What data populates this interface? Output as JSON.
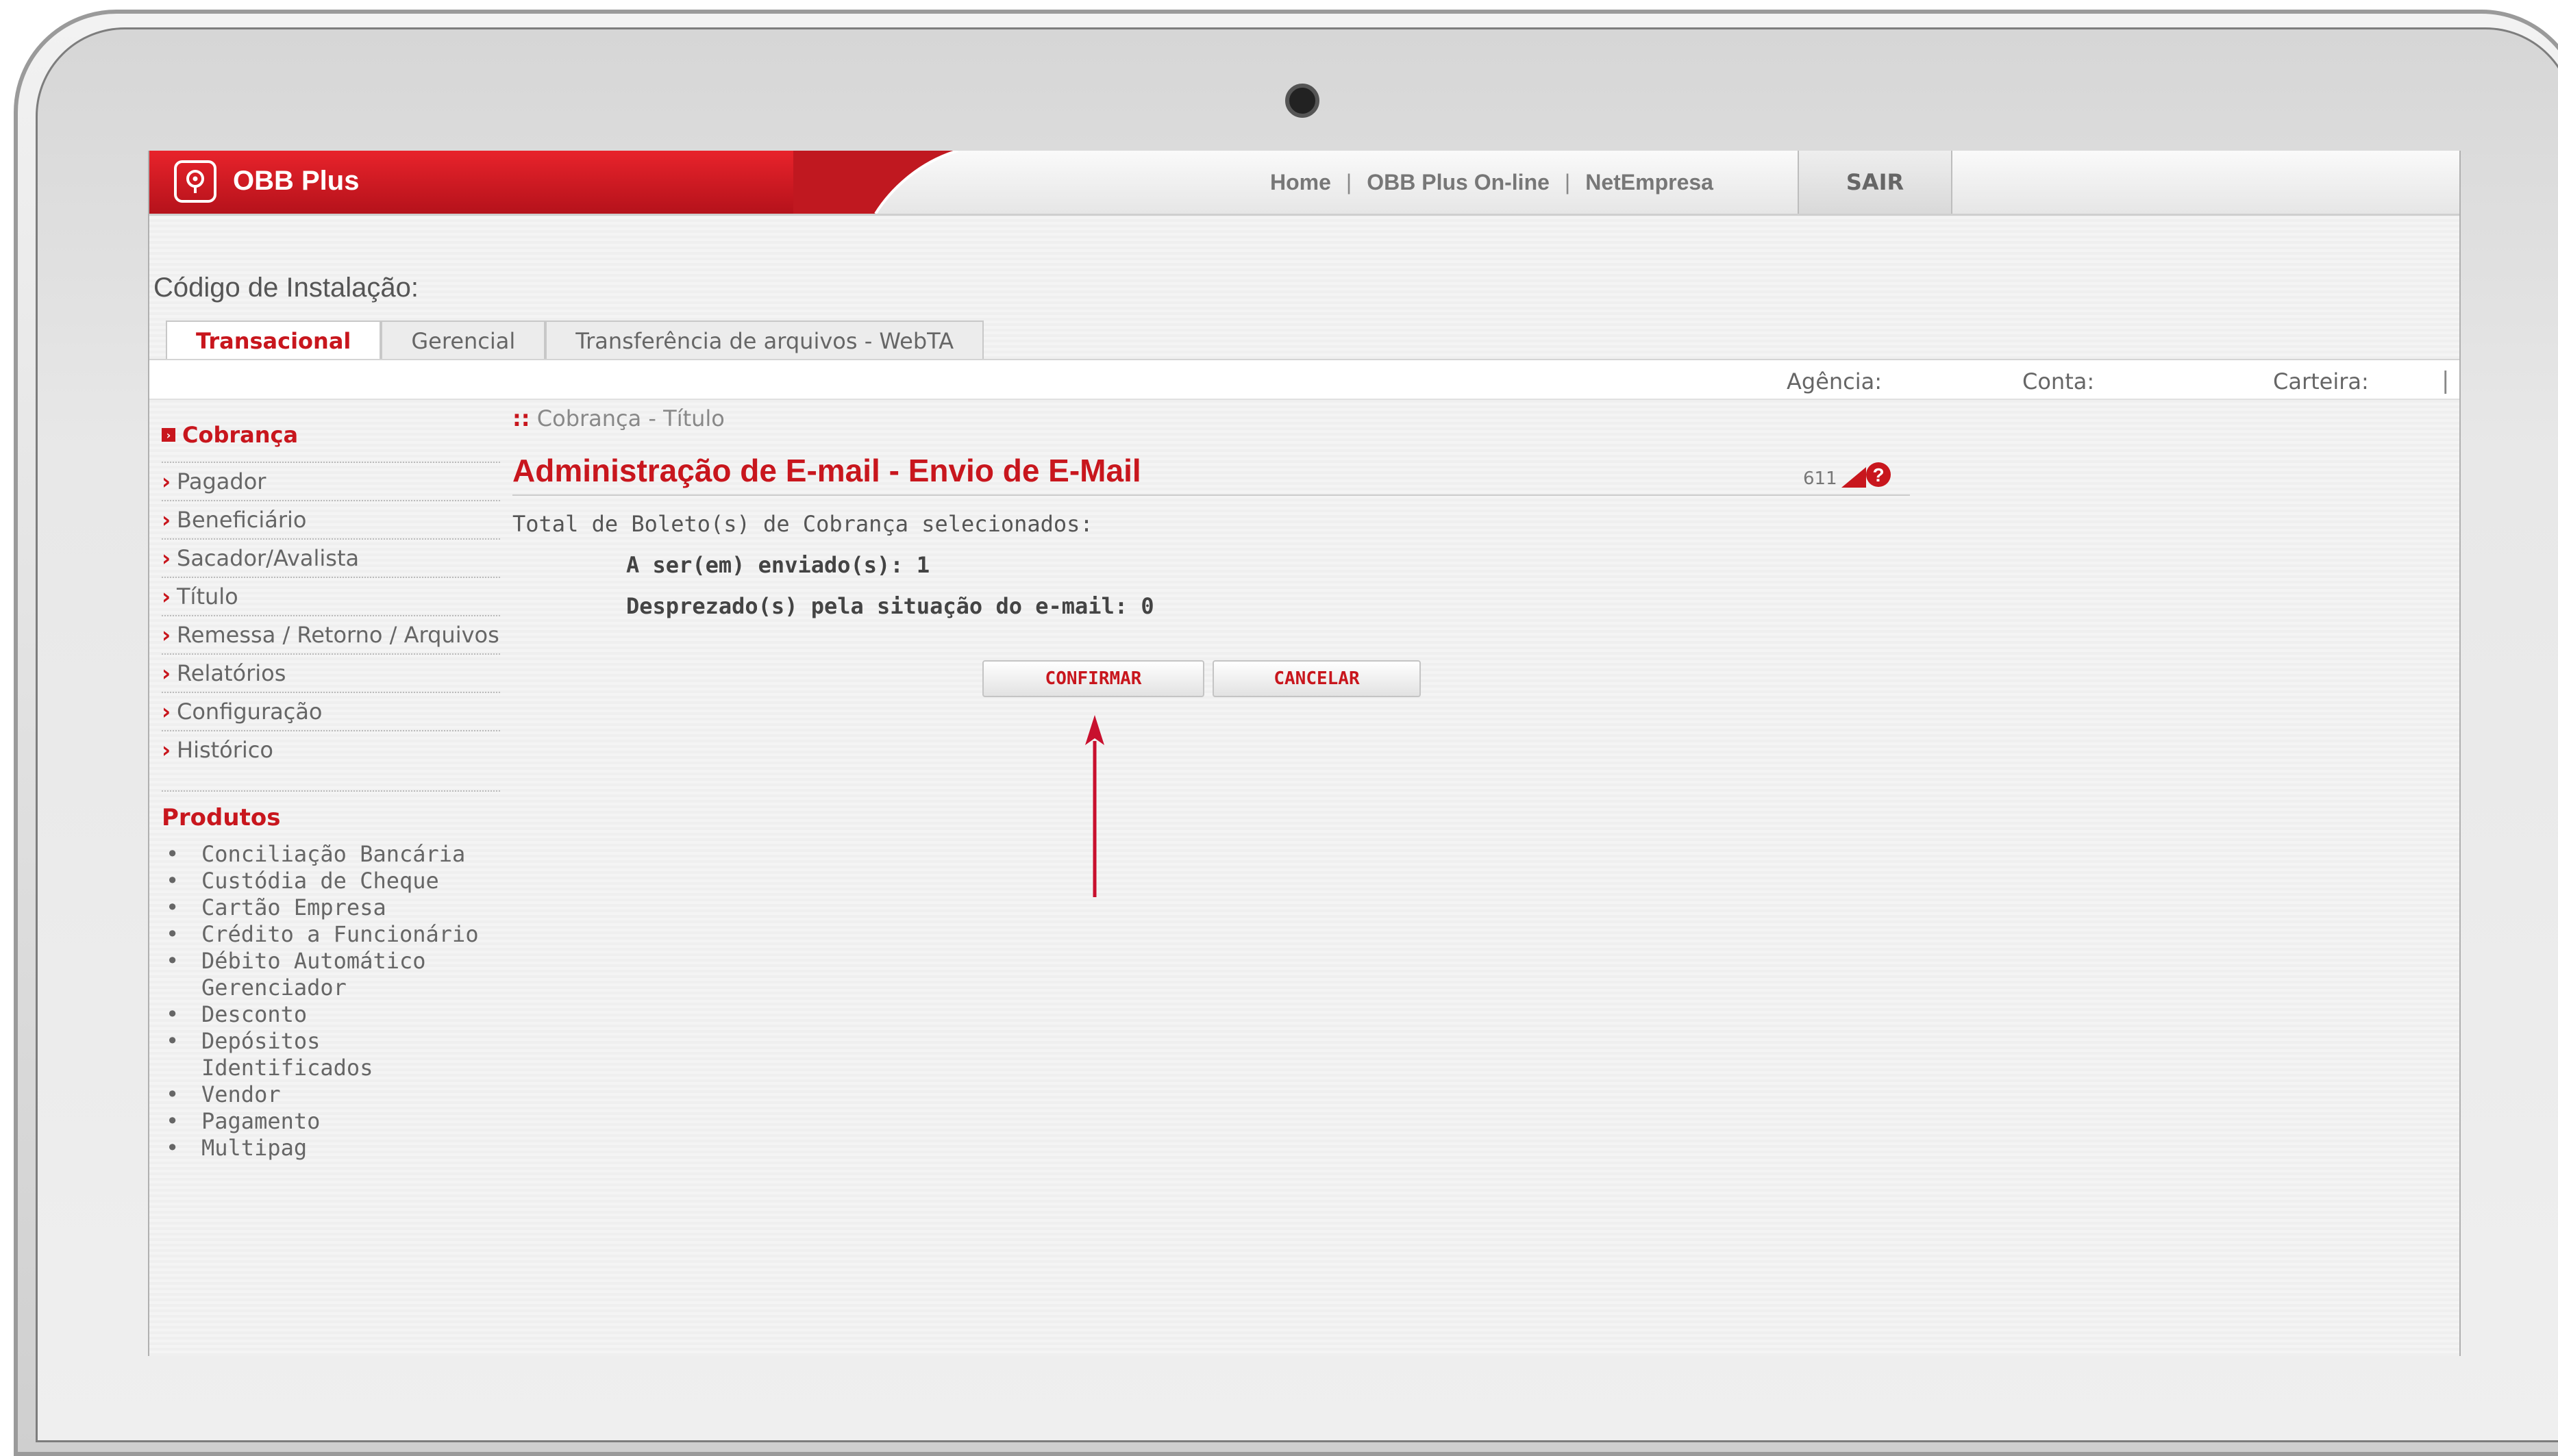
{
  "brand": {
    "name": "OBB Plus"
  },
  "topnav": {
    "items": [
      "Home",
      "OBB Plus On-line",
      "NetEmpresa"
    ],
    "separator": "|",
    "logout": "SAIR"
  },
  "install_label": "Código de Instalação:",
  "tabs": [
    "Transacional",
    "Gerencial",
    "Transferência de arquivos - WebTA"
  ],
  "account": {
    "agencia": "Agência:",
    "conta": "Conta:",
    "carteira": "Carteira:",
    "pipe": "|"
  },
  "sidebar": {
    "section_title": "Cobrança",
    "items": [
      "Pagador",
      "Beneficiário",
      "Sacador/Avalista",
      "Título",
      "Remessa / Retorno / Arquivos",
      "Relatórios",
      "Configuração",
      "Histórico"
    ],
    "products_title": "Produtos",
    "products": [
      "Conciliação Bancária",
      "Custódia de Cheque",
      "Cartão Empresa",
      "Crédito a Funcionário",
      "Débito Automático Gerenciador",
      "Desconto",
      "Depósitos Identificados",
      "Vendor",
      "Pagamento",
      "Multipag"
    ]
  },
  "main": {
    "breadcrumb_marker": "::",
    "breadcrumb": "Cobrança - Título",
    "title": "Administração de E-mail - Envio de E-Mail",
    "code": "611",
    "total_label": "Total de Boleto(s) de Cobrança selecionados:",
    "to_send_label": "A ser(em) enviado(s):",
    "to_send_value": "1",
    "discarded_label": "Desprezado(s) pela situação do e-mail:",
    "discarded_value": "0",
    "confirm": "CONFIRMAR",
    "cancel": "CANCELAR"
  },
  "colors": {
    "brand_red": "#c8161d",
    "arrow": "#c8102e"
  }
}
